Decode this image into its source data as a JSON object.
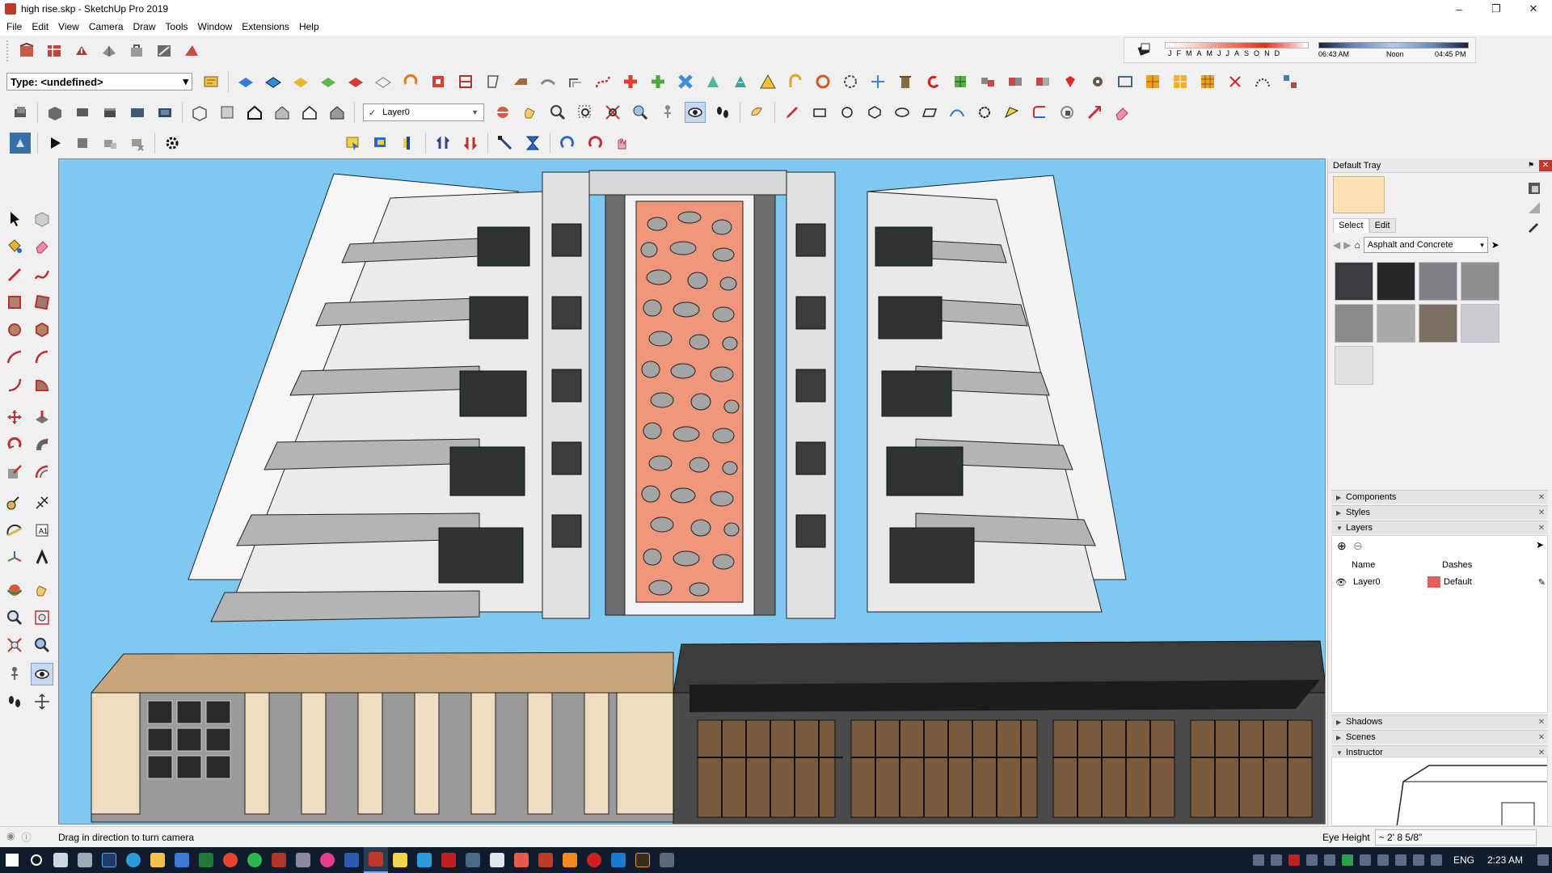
{
  "window": {
    "title": "high rise.skp - SketchUp Pro 2019"
  },
  "menu": [
    "File",
    "Edit",
    "View",
    "Camera",
    "Draw",
    "Tools",
    "Window",
    "Extensions",
    "Help"
  ],
  "toolbar": {
    "type_combo": "Type: <undefined>",
    "layer_combo": "Layer0"
  },
  "shadow": {
    "months": [
      "J",
      "F",
      "M",
      "A",
      "M",
      "J",
      "J",
      "A",
      "S",
      "O",
      "N",
      "D"
    ],
    "time_start": "06:43 AM",
    "time_mid": "Noon",
    "time_end": "04:45 PM"
  },
  "tray": {
    "title": "Default Tray",
    "tabs": [
      "Select",
      "Edit"
    ],
    "material_collection": "Asphalt and Concrete",
    "swatch_colors": [
      "#3b3a3e",
      "#27272a",
      "#7f8387",
      "#8c8e90",
      "#8b8b8c",
      "#a8aaa9",
      "#7b6f62",
      "#c9ccd0",
      "#e1e2e4"
    ],
    "panels": {
      "components": "Components",
      "styles": "Styles",
      "layers": "Layers",
      "shadows": "Shadows",
      "scenes": "Scenes",
      "instructor": "Instructor"
    },
    "layers": {
      "col_name": "Name",
      "col_dashes": "Dashes",
      "row_name": "Layer0",
      "row_dashes": "Default",
      "row_color": "#e55c5c"
    }
  },
  "status": {
    "message": "Drag in direction to turn camera",
    "measure_label": "Eye Height",
    "measure_value": "~ 2' 8 5/8\""
  },
  "taskbar": {
    "lang": "ENG",
    "time": "2:23 AM"
  }
}
